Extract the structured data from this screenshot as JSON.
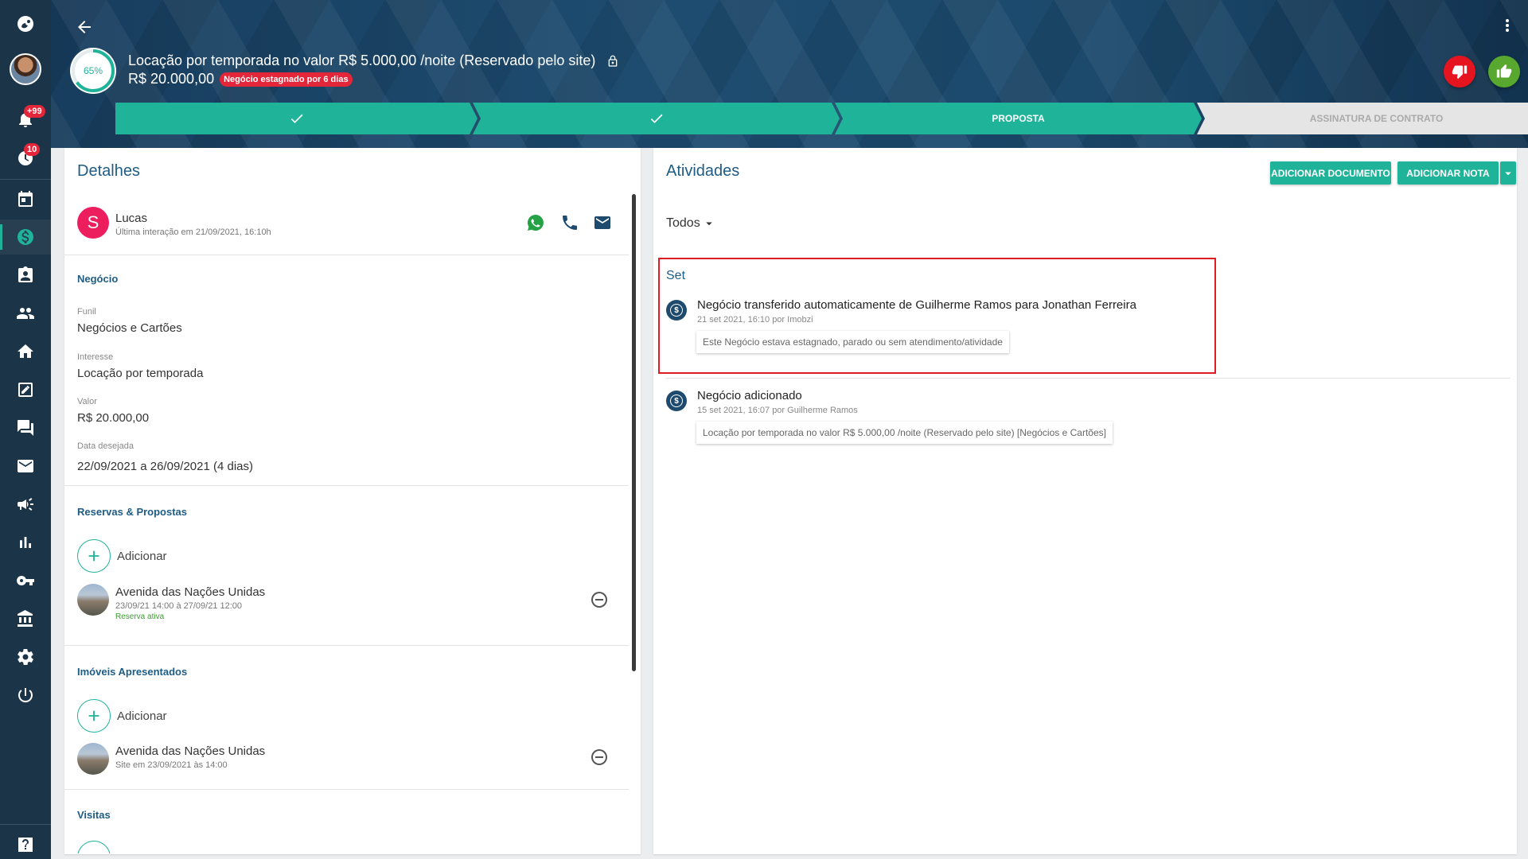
{
  "sidebar": {
    "items": [
      {
        "name": "logo",
        "icon": "imobzi-logo-icon"
      },
      {
        "name": "user-avatar",
        "icon": "avatar"
      },
      {
        "name": "notifications",
        "icon": "bell-icon",
        "badge": "+99"
      },
      {
        "name": "tasks",
        "icon": "alarm-icon",
        "badge": "10"
      },
      {
        "name": "calendar",
        "icon": "calendar-icon"
      },
      {
        "name": "deals",
        "icon": "dollar-icon",
        "active": true
      },
      {
        "name": "contacts",
        "icon": "contact-card-icon"
      },
      {
        "name": "people",
        "icon": "people-icon"
      },
      {
        "name": "properties",
        "icon": "home-icon"
      },
      {
        "name": "contracts",
        "icon": "edit-document-icon"
      },
      {
        "name": "messages",
        "icon": "chat-icon"
      },
      {
        "name": "email",
        "icon": "mail-icon"
      },
      {
        "name": "marketing",
        "icon": "megaphone-icon"
      },
      {
        "name": "reports",
        "icon": "bar-chart-icon"
      },
      {
        "name": "keys",
        "icon": "key-icon"
      },
      {
        "name": "finance",
        "icon": "bank-icon"
      },
      {
        "name": "settings",
        "icon": "gear-icon"
      },
      {
        "name": "logout",
        "icon": "power-icon"
      },
      {
        "name": "help",
        "icon": "help-icon"
      }
    ]
  },
  "header": {
    "progress": "65%",
    "progress_value": 0.65,
    "title": "Locação por temporada no valor R$ 5.000,00 /noite (Reservado pelo site)",
    "value": "R$ 20.000,00",
    "stagnant_badge": "Negócio estagnado por 6 dias",
    "stages": [
      {
        "label": "",
        "status": "done"
      },
      {
        "label": "",
        "status": "done"
      },
      {
        "label": "PROPOSTA",
        "status": "current"
      },
      {
        "label": "ASSINATURA DE CONTRATO",
        "status": "future"
      }
    ]
  },
  "details": {
    "title": "Detalhes",
    "contact": {
      "initial": "S",
      "name": "Lucas",
      "last_interaction": "Última interação em 21/09/2021, 16:10h"
    },
    "negocio": {
      "section": "Negócio",
      "fields": [
        {
          "label": "Funil",
          "value": "Negócios e Cartões"
        },
        {
          "label": "Interesse",
          "value": "Locação por temporada"
        },
        {
          "label": "Valor",
          "value": "R$ 20.000,00"
        },
        {
          "label": "Data desejada",
          "value": "22/09/2021 a 26/09/2021 (4 dias)"
        }
      ]
    },
    "reservas": {
      "section": "Reservas & Propostas",
      "add_label": "Adicionar",
      "item": {
        "name": "Avenida das Nações Unidas",
        "dates": "23/09/21 14:00 à 27/09/21 12:00",
        "status": "Reserva ativa"
      }
    },
    "imoveis": {
      "section": "Imóveis Apresentados",
      "add_label": "Adicionar",
      "item": {
        "name": "Avenida das Nações Unidas",
        "info": "Site em 23/09/2021 às 14:00"
      }
    },
    "visitas": {
      "section": "Visitas"
    }
  },
  "activities": {
    "title": "Atividades",
    "add_document": "ADICIONAR DOCUMENTO",
    "add_note": "ADICIONAR NOTA",
    "filter": "Todos",
    "month": "Set",
    "items": [
      {
        "icon": "$",
        "title": "Negócio transferido automaticamente de Guilherme Ramos para Jonathan Ferreira",
        "meta": "21 set 2021, 16:10 por Imobzi",
        "note": "Este Negócio estava estagnado, parado ou sem atendimento/atividade"
      },
      {
        "icon": "$",
        "title": "Negócio adicionado",
        "meta": "15 set 2021, 16:07 por Guilherme Ramos",
        "note": "Locação por temporada no valor R$ 5.000,00 /noite (Reservado pelo site) [Negócios e Cartões]"
      }
    ]
  },
  "colors": {
    "accent": "#1fb39a",
    "sidebar": "#1b3448",
    "header": "#1d4769",
    "danger": "#e3263a",
    "success": "#58a82f",
    "link": "#1e5c85"
  }
}
